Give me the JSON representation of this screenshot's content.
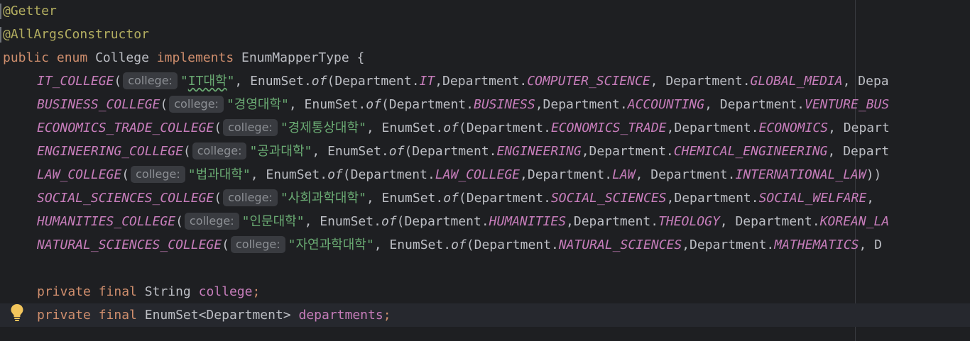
{
  "editor": {
    "lines": [
      {
        "annotation": "@Getter"
      },
      {
        "annotation": "@AllArgsConstructor"
      },
      {
        "kw_public": "public",
        "kw_enum": "enum",
        "class_name": "College",
        "kw_implements": "implements",
        "interface": "EnumMapperType",
        "brace": " {"
      },
      {
        "constant": "IT_COLLEGE",
        "hint": "college:",
        "str_prefix": "\"",
        "str_squiggle": "IT대학",
        "str_suffix": "\"",
        "tail": [
          {
            "t": ", EnumSet.",
            "c": "punc"
          },
          {
            "t": "of",
            "c": "meth"
          },
          {
            "t": "(Department.",
            "c": "punc"
          },
          {
            "t": "IT",
            "c": "const"
          },
          {
            "t": ",Department.",
            "c": "punc"
          },
          {
            "t": "COMPUTER_SCIENCE",
            "c": "const"
          },
          {
            "t": ", Department.",
            "c": "punc"
          },
          {
            "t": "GLOBAL_MEDIA",
            "c": "const"
          },
          {
            "t": ", Depa",
            "c": "punc"
          }
        ]
      },
      {
        "constant": "BUSINESS_COLLEGE",
        "hint": "college:",
        "str": "\"경영대학\"",
        "tail": [
          {
            "t": ", EnumSet.",
            "c": "punc"
          },
          {
            "t": "of",
            "c": "meth"
          },
          {
            "t": "(Department.",
            "c": "punc"
          },
          {
            "t": "BUSINESS",
            "c": "const"
          },
          {
            "t": ",Department.",
            "c": "punc"
          },
          {
            "t": "ACCOUNTING",
            "c": "const"
          },
          {
            "t": ", Department.",
            "c": "punc"
          },
          {
            "t": "VENTURE_BUS",
            "c": "const"
          }
        ]
      },
      {
        "constant": "ECONOMICS_TRADE_COLLEGE",
        "hint": "college:",
        "str": "\"경제통상대학\"",
        "tail": [
          {
            "t": ", EnumSet.",
            "c": "punc"
          },
          {
            "t": "of",
            "c": "meth"
          },
          {
            "t": "(Department.",
            "c": "punc"
          },
          {
            "t": "ECONOMICS_TRADE",
            "c": "const"
          },
          {
            "t": ",Department.",
            "c": "punc"
          },
          {
            "t": "ECONOMICS",
            "c": "const"
          },
          {
            "t": ", Depart",
            "c": "punc"
          }
        ]
      },
      {
        "constant": "ENGINEERING_COLLEGE",
        "hint": "college:",
        "str": "\"공과대학\"",
        "tail": [
          {
            "t": ", EnumSet.",
            "c": "punc"
          },
          {
            "t": "of",
            "c": "meth"
          },
          {
            "t": "(Department.",
            "c": "punc"
          },
          {
            "t": "ENGINEERING",
            "c": "const"
          },
          {
            "t": ",Department.",
            "c": "punc"
          },
          {
            "t": "CHEMICAL_ENGINEERING",
            "c": "const"
          },
          {
            "t": ", Depart",
            "c": "punc"
          }
        ]
      },
      {
        "constant": "LAW_COLLEGE",
        "hint": "college:",
        "str": "\"법과대학\"",
        "tail": [
          {
            "t": ", EnumSet.",
            "c": "punc"
          },
          {
            "t": "of",
            "c": "meth"
          },
          {
            "t": "(Department.",
            "c": "punc"
          },
          {
            "t": "LAW_COLLEGE",
            "c": "const"
          },
          {
            "t": ",Department.",
            "c": "punc"
          },
          {
            "t": "LAW",
            "c": "const"
          },
          {
            "t": ", Department.",
            "c": "punc"
          },
          {
            "t": "INTERNATIONAL_LAW",
            "c": "const"
          },
          {
            "t": "))",
            "c": "punc"
          }
        ]
      },
      {
        "constant": "SOCIAL_SCIENCES_COLLEGE",
        "hint": "college:",
        "str": "\"사회과학대학\"",
        "tail": [
          {
            "t": ", EnumSet.",
            "c": "punc"
          },
          {
            "t": "of",
            "c": "meth"
          },
          {
            "t": "(Department.",
            "c": "punc"
          },
          {
            "t": "SOCIAL_SCIENCES",
            "c": "const"
          },
          {
            "t": ",Department.",
            "c": "punc"
          },
          {
            "t": "SOCIAL_WELFARE",
            "c": "const"
          },
          {
            "t": ", ",
            "c": "punc"
          }
        ]
      },
      {
        "constant": "HUMANITIES_COLLEGE",
        "hint": "college:",
        "str": "\"인문대학\"",
        "tail": [
          {
            "t": ", EnumSet.",
            "c": "punc"
          },
          {
            "t": "of",
            "c": "meth"
          },
          {
            "t": "(Department.",
            "c": "punc"
          },
          {
            "t": "HUMANITIES",
            "c": "const"
          },
          {
            "t": ",Department.",
            "c": "punc"
          },
          {
            "t": "THEOLOGY",
            "c": "const"
          },
          {
            "t": ", Department.",
            "c": "punc"
          },
          {
            "t": "KOREAN_LA",
            "c": "const"
          }
        ]
      },
      {
        "constant": "NATURAL_SCIENCES_COLLEGE",
        "hint": "college:",
        "str": "\"자연과학대학\"",
        "tail": [
          {
            "t": ", EnumSet.",
            "c": "punc"
          },
          {
            "t": "of",
            "c": "meth"
          },
          {
            "t": "(Department.",
            "c": "punc"
          },
          {
            "t": "NATURAL_SCIENCES",
            "c": "const"
          },
          {
            "t": ",Department.",
            "c": "punc"
          },
          {
            "t": "MATHEMATICS",
            "c": "const"
          },
          {
            "t": ", D",
            "c": "punc"
          }
        ]
      },
      {
        "blank": ""
      },
      {
        "kw_private": "private",
        "kw_final": "final",
        "type": "String",
        "field": "college",
        "semi": ";"
      },
      {
        "kw_private": "private",
        "kw_final": "final",
        "type": "EnumSet<Department>",
        "field": "departments",
        "semi": ";"
      }
    ],
    "lightbulb_icon": "lightbulb-icon",
    "colors": {
      "background": "#1e1f22",
      "keyword": "#cf8e6d",
      "annotation": "#b3ae60",
      "constant": "#c77dbb",
      "string": "#6aab73",
      "text": "#bcbec4",
      "hint_bg": "#393b40"
    }
  }
}
